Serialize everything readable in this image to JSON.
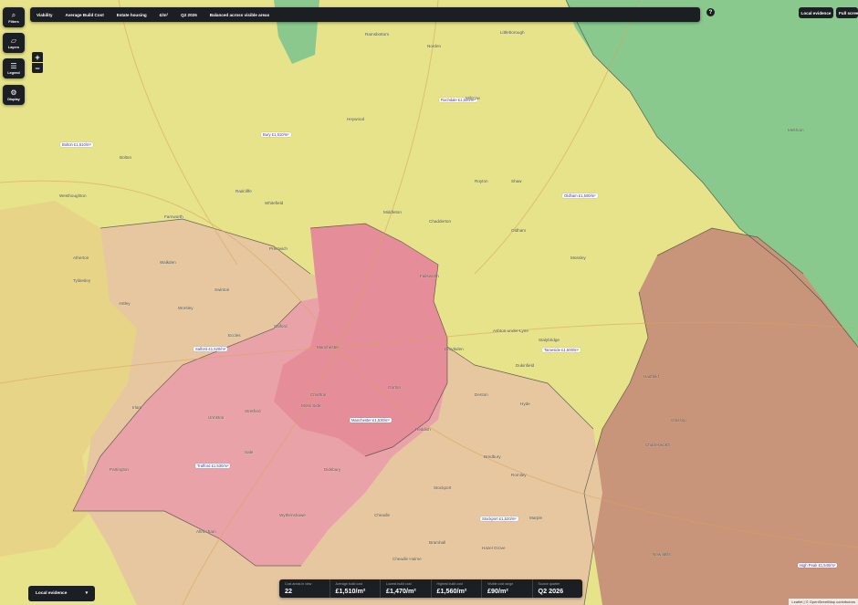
{
  "toolbar": {
    "chips": [
      "Viability",
      "Average Build Cost",
      "Estate housing",
      "£/m²",
      "Q2 2026",
      "Balanced across visible areas"
    ],
    "local_evidence_label": "Local evidence",
    "fullscreen_label": "Full screen",
    "help_label": "?"
  },
  "sidebar": {
    "buttons": [
      {
        "name": "filters",
        "label": "Filters",
        "icon": "search-icon",
        "glyph": "⌕"
      },
      {
        "name": "layers",
        "label": "Layers",
        "icon": "layers-icon",
        "glyph": "▱"
      },
      {
        "name": "legend",
        "label": "Legend",
        "icon": "list-icon",
        "glyph": "☰"
      },
      {
        "name": "display",
        "label": "Display",
        "icon": "gear-icon",
        "glyph": "⚙"
      }
    ],
    "zoom_in": "+",
    "zoom_out": "−"
  },
  "stats": [
    {
      "label": "Cost areas in view",
      "value": "22"
    },
    {
      "label": "Average build cost",
      "value": "£1,510/m²"
    },
    {
      "label": "Lowest build cost",
      "value": "£1,470/m²"
    },
    {
      "label": "Highest build cost",
      "value": "£1,560/m²"
    },
    {
      "label": "Visible cost range",
      "value": "£90/m²"
    },
    {
      "label": "Source quarter",
      "value": "Q2 2026"
    }
  ],
  "evidence_panel": {
    "label": "Local evidence",
    "caret": "▾"
  },
  "attribution": "Leaflet | © OpenStreetMap contributors",
  "colors": {
    "yellow_zone": "#e6e38a",
    "pink_zone": "#e9a3a8",
    "deep_pink_zone": "#e58e9a",
    "peach_zone": "#e7c7a0",
    "green_zone": "#89c98d",
    "brown_zone": "#c8957a",
    "panel_bg": "#1b1f24"
  },
  "map_labels": {
    "districts": [
      "Bolton £1,510/m²",
      "Bury £1,510/m²",
      "Rochdale £1,500/m²",
      "Oldham £1,500/m²",
      "Salford £1,520/m²",
      "Tameside £1,500/m²",
      "Manchester £1,530/m²",
      "Trafford £1,530/m²",
      "Stockport £1,520/m²",
      "High Peak £1,540/m²"
    ],
    "places": [
      "Littleborough",
      "Norden",
      "Ramsbottom",
      "Milnrow",
      "Heywood",
      "Bolton",
      "Radcliffe",
      "Whitefield",
      "Middleton",
      "Royton",
      "Shaw",
      "Chadderton",
      "Oldham",
      "Prestwich",
      "Farnworth",
      "Walkden",
      "Swinton",
      "Worsley",
      "Eccles",
      "Salford",
      "Manchester",
      "Failsworth",
      "Droylsden",
      "Ashton-under-Lyne",
      "Stalybridge",
      "Mossley",
      "Dukinfield",
      "Hyde",
      "Denton",
      "Stretford",
      "Sale",
      "Urmston",
      "Partington",
      "Altrincham",
      "Wythenshawe",
      "Cheadle",
      "Stockport",
      "Bramhall",
      "Marple",
      "Hadfield",
      "Glossop",
      "Charlesworth",
      "New Mills",
      "Meltham",
      "Atherton",
      "Tyldesley",
      "Astley",
      "Irlam",
      "Westhoughton",
      "Cheadle Hulme",
      "Hazel Grove",
      "Chorlton",
      "Didsbury",
      "Moss Side",
      "Gorton",
      "Reddish",
      "Bredbury",
      "Romiley"
    ]
  }
}
